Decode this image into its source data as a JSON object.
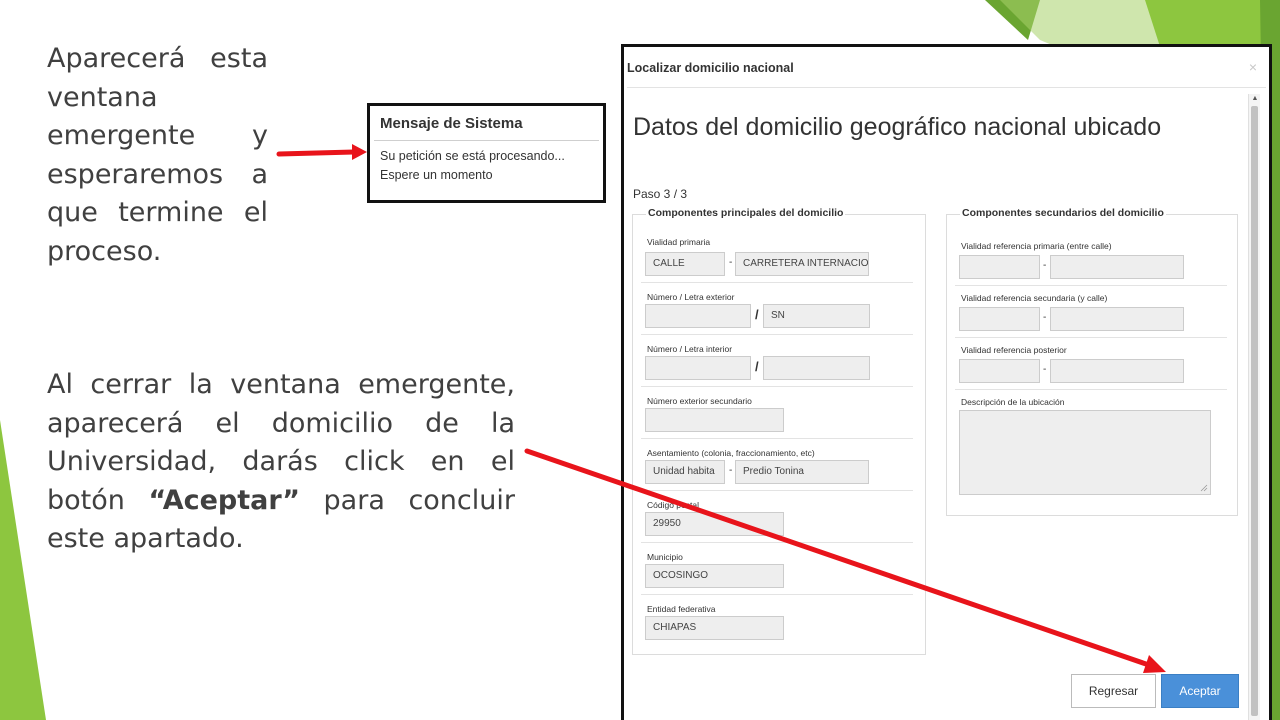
{
  "slide": {
    "text1": "Aparecerá esta ventana emergente y esperaremos a que termine el proceso.",
    "text2_part1": "Al cerrar la ventana emergente, aparecerá el domicilio de la Universidad, darás click en el botón ",
    "text2_bold": "“Aceptar”",
    "text2_part2": " para concluir este apartado."
  },
  "system_message": {
    "title": "Mensaje de Sistema",
    "line1": "Su petición se está procesando...",
    "line2": "Espere un momento"
  },
  "dialog": {
    "title": "Localizar domicilio nacional",
    "close": "×",
    "heading": "Datos del domicilio geográfico nacional ubicado",
    "step": "Paso 3 / 3",
    "principal": {
      "legend": "Componentes principales del domicilio",
      "vialidad_primaria_label": "Vialidad primaria",
      "vialidad_tipo": "CALLE",
      "vialidad_nombre": "CARRETERA INTERNACION",
      "num_ext_label": "Número / Letra exterior",
      "num_ext": "",
      "letra_ext": "SN",
      "num_int_label": "Número / Letra interior",
      "num_int": "",
      "letra_int": "",
      "num_ext_sec_label": "Número exterior secundario",
      "num_ext_sec": "",
      "asentamiento_label": "Asentamiento (colonia, fraccionamiento, etc)",
      "asentamiento_tipo": "Unidad habita",
      "asentamiento_nombre": "Predio Tonina",
      "cp_label": "Código postal",
      "cp": "29950",
      "municipio_label": "Municipio",
      "municipio": "OCOSINGO",
      "entidad_label": "Entidad federativa",
      "entidad": "CHIAPAS",
      "dash": "-",
      "slash": "/"
    },
    "secundario": {
      "legend": "Componentes secundarios del domicilio",
      "ref_primaria_label": "Vialidad referencia primaria (entre calle)",
      "ref_secundaria_label": "Vialidad referencia secundaria (y calle)",
      "ref_posterior_label": "Vialidad referencia posterior",
      "descripcion_label": "Descripción de la ubicación",
      "dash": "-"
    },
    "buttons": {
      "regresar": "Regresar",
      "aceptar": "Aceptar"
    }
  },
  "colors": {
    "accent_green": "#8dc63f",
    "dark_green": "#6aa531",
    "arrow_red": "#e8141b",
    "button_blue": "#4a90d9"
  }
}
